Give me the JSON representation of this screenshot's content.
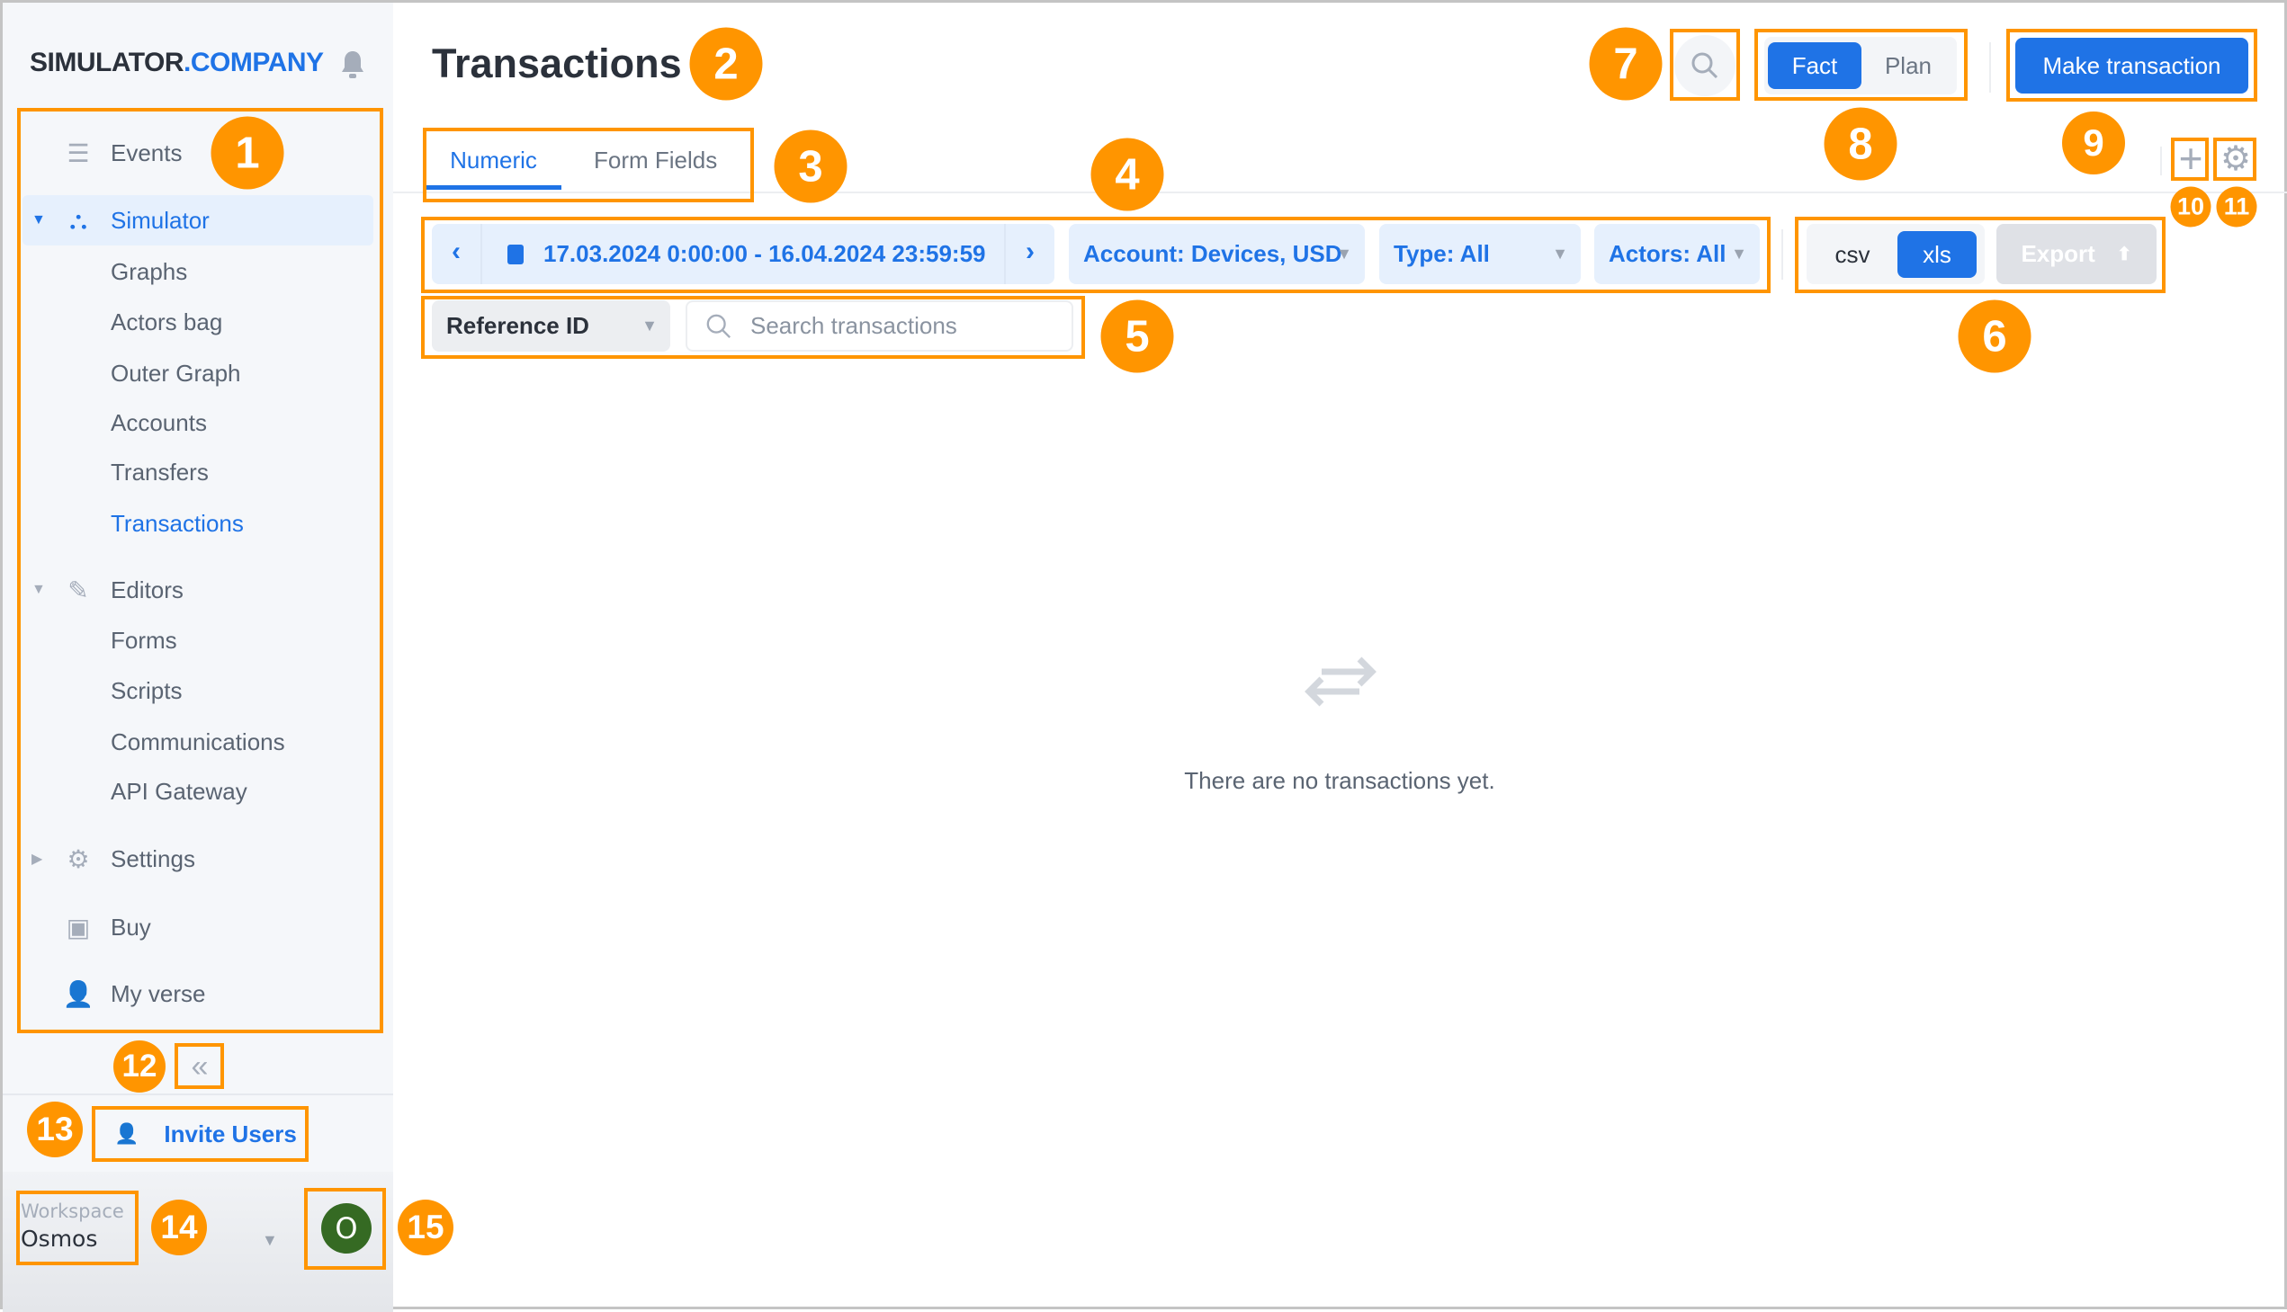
{
  "brand": {
    "part1": "SIMULATOR",
    "part2": ".COMPANY"
  },
  "sidebar": {
    "items": [
      {
        "label": "Events",
        "icon": "events-icon"
      },
      {
        "label": "Simulator",
        "icon": "simulator-icon",
        "expanded": true,
        "selected": true
      },
      {
        "label": "Graphs"
      },
      {
        "label": "Actors bag"
      },
      {
        "label": "Outer Graph"
      },
      {
        "label": "Accounts"
      },
      {
        "label": "Transfers"
      },
      {
        "label": "Transactions",
        "active": true
      },
      {
        "label": "Editors",
        "icon": "pencil-icon",
        "expanded": true
      },
      {
        "label": "Forms"
      },
      {
        "label": "Scripts"
      },
      {
        "label": "Communications"
      },
      {
        "label": "API Gateway"
      },
      {
        "label": "Settings",
        "icon": "gear-icon",
        "expanded": false
      },
      {
        "label": "Buy",
        "icon": "wallet-icon"
      },
      {
        "label": "My verse",
        "icon": "user-icon"
      }
    ],
    "collapse": "«",
    "invite": "Invite Users",
    "workspace": {
      "label": "Workspace",
      "value": "Osmos"
    },
    "avatar": "O"
  },
  "header": {
    "title": "Transactions",
    "mode": {
      "options": [
        "Fact",
        "Plan"
      ],
      "selected": "Fact"
    },
    "make_transaction": "Make transaction"
  },
  "tabs": [
    {
      "label": "Numeric",
      "active": true
    },
    {
      "label": "Form Fields"
    }
  ],
  "filters": {
    "date_range": "17.03.2024 0:00:00 - 16.04.2024 23:59:59",
    "account": "Account: Devices, USD",
    "type": "Type: All",
    "actors": "Actors: All"
  },
  "export": {
    "formats": [
      "csv",
      "xls"
    ],
    "selected": "xls",
    "button": "Export"
  },
  "search": {
    "field": "Reference ID",
    "placeholder": "Search transactions"
  },
  "empty": {
    "message": "There are no transactions yet."
  },
  "annotations": [
    "1",
    "2",
    "3",
    "4",
    "5",
    "6",
    "7",
    "8",
    "9",
    "10",
    "11",
    "12",
    "13",
    "14",
    "15"
  ],
  "colors": {
    "accent": "#1f73e6",
    "annotation": "#ff9500",
    "avatar": "#356a23"
  }
}
